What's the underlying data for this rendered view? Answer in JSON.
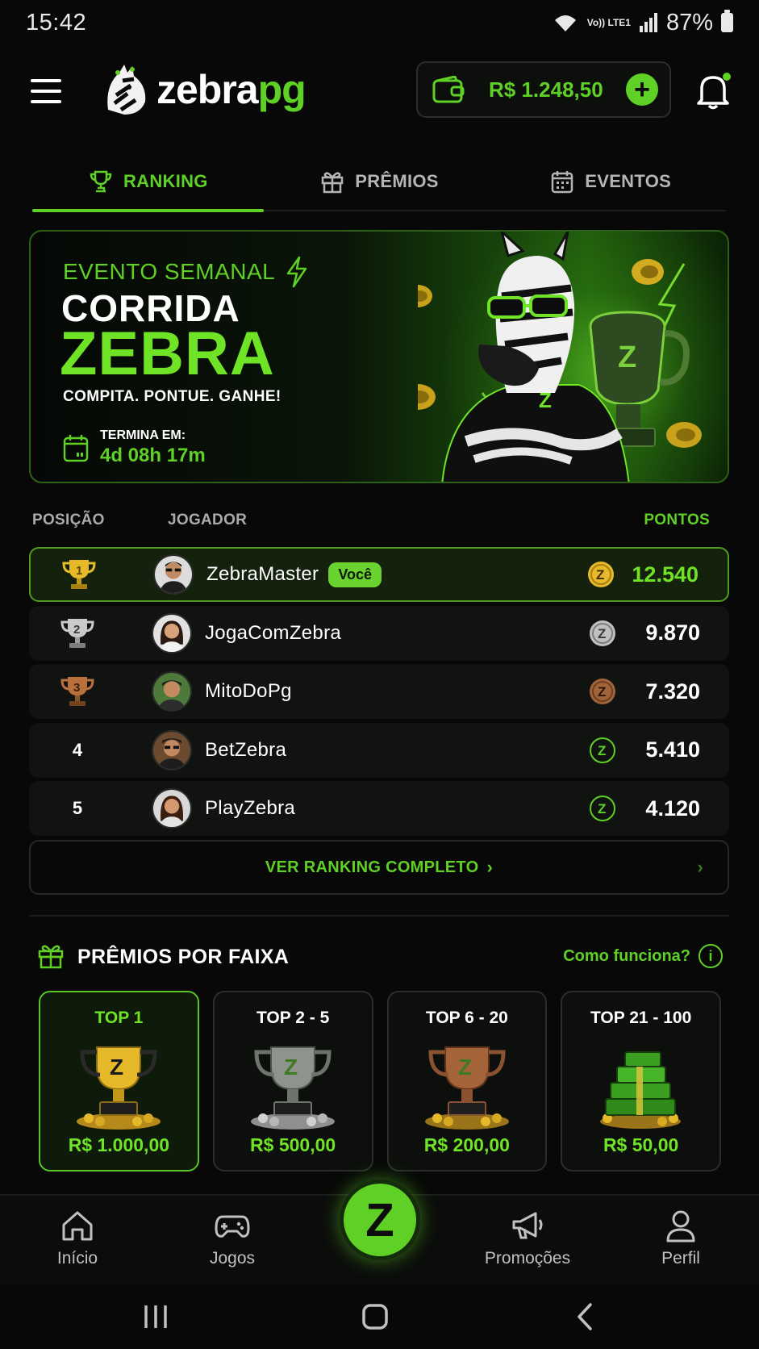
{
  "status_bar": {
    "time": "15:42",
    "network": "Vo)) LTE1",
    "battery": "87%"
  },
  "header": {
    "logo_left": "zebra",
    "logo_right": "pg",
    "balance": "R$ 1.248,50",
    "add_symbol": "+"
  },
  "tabs": [
    {
      "label": "RANKING",
      "icon": "trophy-icon",
      "active": true
    },
    {
      "label": "PRÊMIOS",
      "icon": "gift-icon",
      "active": false
    },
    {
      "label": "EVENTOS",
      "icon": "calendar-icon",
      "active": false
    }
  ],
  "banner": {
    "kicker": "EVENTO SEMANAL",
    "title_line1": "CORRIDA",
    "title_line2": "ZEBRA",
    "tagline": "COMPITA. PONTUE. GANHE!",
    "ends_label": "TERMINA EM:",
    "ends_value": "4d 08h 17m"
  },
  "ranking": {
    "col_position": "POSIÇÃO",
    "col_player": "JOGADOR",
    "col_points": "PONTOS",
    "you_badge": "Você",
    "rows": [
      {
        "position": "1",
        "name": "ZebraMaster",
        "points": "12.540",
        "is_you": true,
        "medal": "gold"
      },
      {
        "position": "2",
        "name": "JogaComZebra",
        "points": "9.870",
        "is_you": false,
        "medal": "silver"
      },
      {
        "position": "3",
        "name": "MitoDoPg",
        "points": "7.320",
        "is_you": false,
        "medal": "bronze"
      },
      {
        "position": "4",
        "name": "BetZebra",
        "points": "5.410",
        "is_you": false,
        "medal": "none"
      },
      {
        "position": "5",
        "name": "PlayZebra",
        "points": "4.120",
        "is_you": false,
        "medal": "none"
      }
    ],
    "see_all": "VER RANKING COMPLETO"
  },
  "prizes": {
    "title": "PRÊMIOS POR FAIXA",
    "how_it_works": "Como funciona?",
    "cards": [
      {
        "label": "TOP 1",
        "value": "R$ 1.000,00",
        "tier": "gold"
      },
      {
        "label": "TOP 2 - 5",
        "value": "R$ 500,00",
        "tier": "silver"
      },
      {
        "label": "TOP 6 - 20",
        "value": "R$ 200,00",
        "tier": "bronze"
      },
      {
        "label": "TOP 21 - 100",
        "value": "R$ 50,00",
        "tier": "cash"
      }
    ]
  },
  "bottom_nav": {
    "home": "Início",
    "games": "Jogos",
    "center": "Z",
    "promos": "Promoções",
    "profile": "Perfil"
  },
  "colors": {
    "accent": "#5fd026",
    "background": "#070807",
    "card": "#111311"
  }
}
